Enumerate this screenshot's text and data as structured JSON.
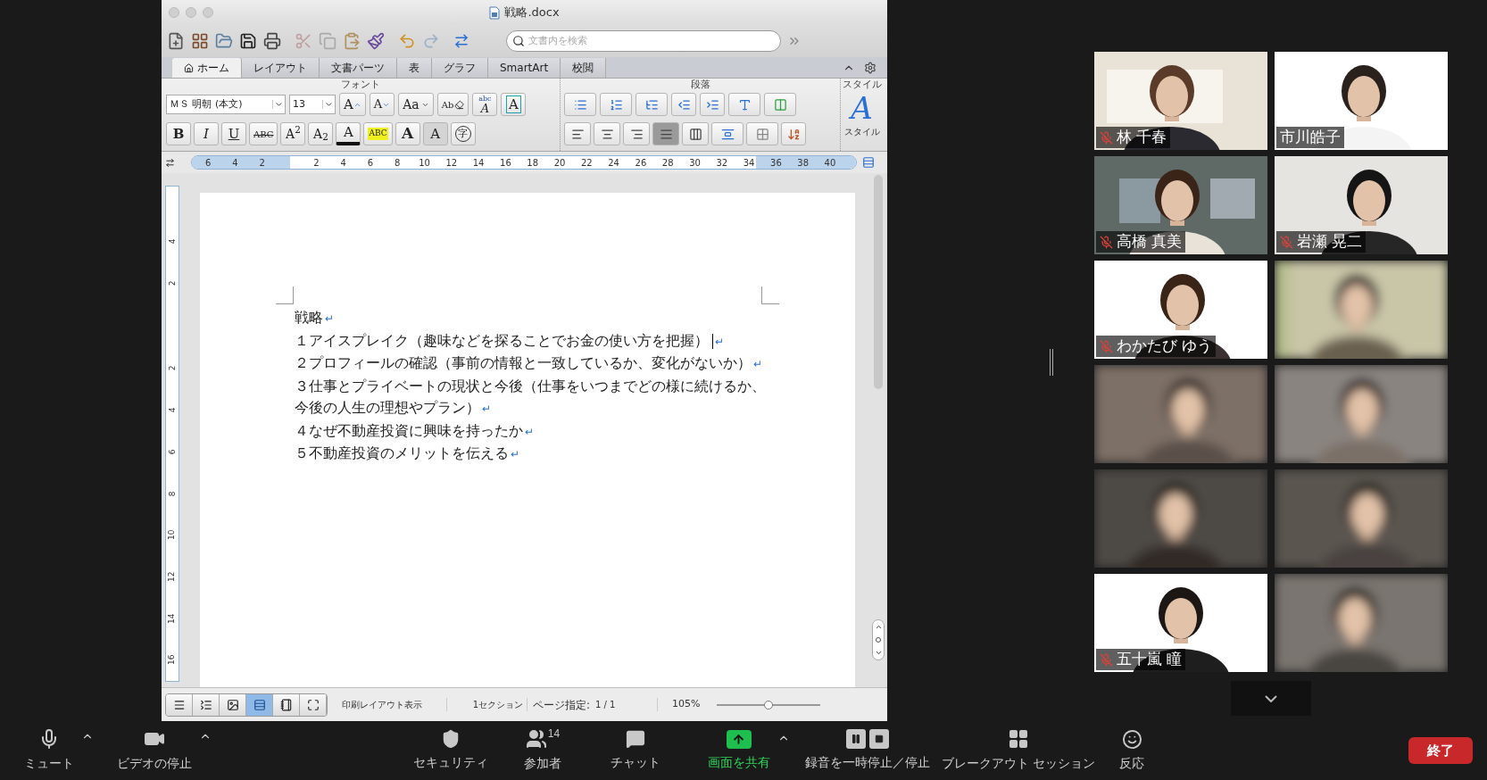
{
  "word_window": {
    "title": "戦略.docx",
    "search": {
      "placeholder": "文書内を検索"
    },
    "tabs": [
      {
        "label": "ホーム",
        "selected": true
      },
      {
        "label": "レイアウト",
        "selected": false
      },
      {
        "label": "文書パーツ",
        "selected": false
      },
      {
        "label": "表",
        "selected": false
      },
      {
        "label": "グラフ",
        "selected": false
      },
      {
        "label": "SmartArt",
        "selected": false
      },
      {
        "label": "校閲",
        "selected": false
      }
    ],
    "ribbon": {
      "group_labels": [
        "フォント",
        "段落",
        "スタイル"
      ],
      "font_name": "ＭＳ 明朝 (本文)",
      "font_size": "13",
      "font_row1": [
        {
          "kind": "grow",
          "label": "A"
        },
        {
          "kind": "shrink",
          "label": "A"
        },
        {
          "kind": "case",
          "label": "Aa"
        },
        {
          "kind": "clear",
          "label": "Ab"
        },
        {
          "kind": "phonetic",
          "label": "abc",
          "sublabel": "A"
        },
        {
          "kind": "border",
          "label": "A"
        }
      ],
      "font_row2": [
        {
          "kind": "bold",
          "label": "B"
        },
        {
          "kind": "italic",
          "label": "I"
        },
        {
          "kind": "underline",
          "label": "U"
        },
        {
          "kind": "strike",
          "label": "ABC"
        },
        {
          "kind": "plain",
          "label": "A$^{2}$"
        },
        {
          "kind": "plain",
          "label": "A$_{2}$"
        },
        {
          "kind": "color",
          "label": "A"
        },
        {
          "kind": "highlight",
          "label": "ABC"
        },
        {
          "kind": "effect",
          "label": "A"
        },
        {
          "kind": "shade",
          "label": "A"
        },
        {
          "kind": "enclose",
          "label": "字"
        }
      ],
      "alignment": [
        {
          "kind": "left",
          "selected": false
        },
        {
          "kind": "center",
          "selected": false
        },
        {
          "kind": "right",
          "selected": false
        },
        {
          "kind": "justify",
          "selected": true
        },
        {
          "kind": "distributed",
          "selected": false
        }
      ],
      "style_button": {
        "glyph": "A",
        "label": "スタイル"
      }
    },
    "ruler_numbers": [
      "6",
      "4",
      "2",
      "2",
      "4",
      "6",
      "8",
      "10",
      "12",
      "14",
      "16",
      "18",
      "20",
      "22",
      "24",
      "26",
      "28",
      "30",
      "32",
      "34",
      "36",
      "38",
      "40"
    ],
    "vertical_ruler_numbers": [
      "4",
      "2",
      "2",
      "4",
      "6",
      "8",
      "10",
      "12",
      "14",
      "16"
    ],
    "document": {
      "return_mark": "↵",
      "paragraphs": [
        {
          "text": "戦略",
          "cursor": false
        },
        {
          "text": "１アイスプレイク（趣味などを探ることでお金の使い方を把握）",
          "cursor": true
        },
        {
          "text": "２プロフィールの確認（事前の情報と一致しているか、変化がないか）",
          "cursor": false
        },
        {
          "text": "３仕事とプライベートの現状と今後（仕事をいつまでどの様に続けるか、今後の人生の理想やプラン）",
          "cursor": false
        },
        {
          "text": "４なぜ不動産投資に興味を持ったか",
          "cursor": false
        },
        {
          "text": "５不動産投資のメリットを伝える",
          "cursor": false
        }
      ]
    },
    "status_bar": {
      "view_buttons": [
        {
          "kind": "draft",
          "selected": false
        },
        {
          "kind": "outline",
          "selected": false
        },
        {
          "kind": "publishing",
          "selected": false
        },
        {
          "kind": "print",
          "selected": true
        },
        {
          "kind": "notebook",
          "selected": false
        },
        {
          "kind": "focus",
          "selected": false
        }
      ],
      "view": "印刷レイアウト表示",
      "section": "1セクション",
      "page_label": "ページ指定:",
      "page": "1 / 1",
      "zoom": "105%",
      "zoom_slider": {
        "level": 0.5
      }
    }
  },
  "participants": [
    {
      "kind": "named",
      "name": "林 千春",
      "muted": true
    },
    {
      "kind": "named",
      "name": "市川皓子",
      "muted": false
    },
    {
      "kind": "named",
      "name": "高橋 真美",
      "muted": true
    },
    {
      "kind": "named",
      "name": "岩瀬 晃二",
      "muted": true
    },
    {
      "kind": "named",
      "name": "わかたび ゆう",
      "muted": true
    },
    {
      "kind": "blurred"
    },
    {
      "kind": "blurred"
    },
    {
      "kind": "blurred"
    },
    {
      "kind": "blurred"
    },
    {
      "kind": "blurred"
    },
    {
      "kind": "named",
      "name": "五十嵐 瞳",
      "muted": true
    },
    {
      "kind": "blurred"
    }
  ],
  "toolbar": {
    "items": [
      {
        "kind": "mute",
        "label": "ミュート",
        "caret": true
      },
      {
        "kind": "video",
        "label": "ビデオの停止",
        "caret": true
      },
      {
        "kind": "security",
        "label": "セキュリティ",
        "caret": false
      },
      {
        "kind": "participants",
        "label": "参加者",
        "caret": false,
        "count": "14"
      },
      {
        "kind": "chat",
        "label": "チャット",
        "caret": false
      },
      {
        "kind": "share",
        "label": "画面を共有",
        "caret": true
      },
      {
        "kind": "record",
        "label": "録音を一時停止／停止",
        "caret": false
      },
      {
        "kind": "breakout",
        "label": "ブレークアウト セッション",
        "caret": false
      },
      {
        "kind": "reaction",
        "label": "反応",
        "caret": false
      }
    ],
    "end_button": "終了"
  }
}
